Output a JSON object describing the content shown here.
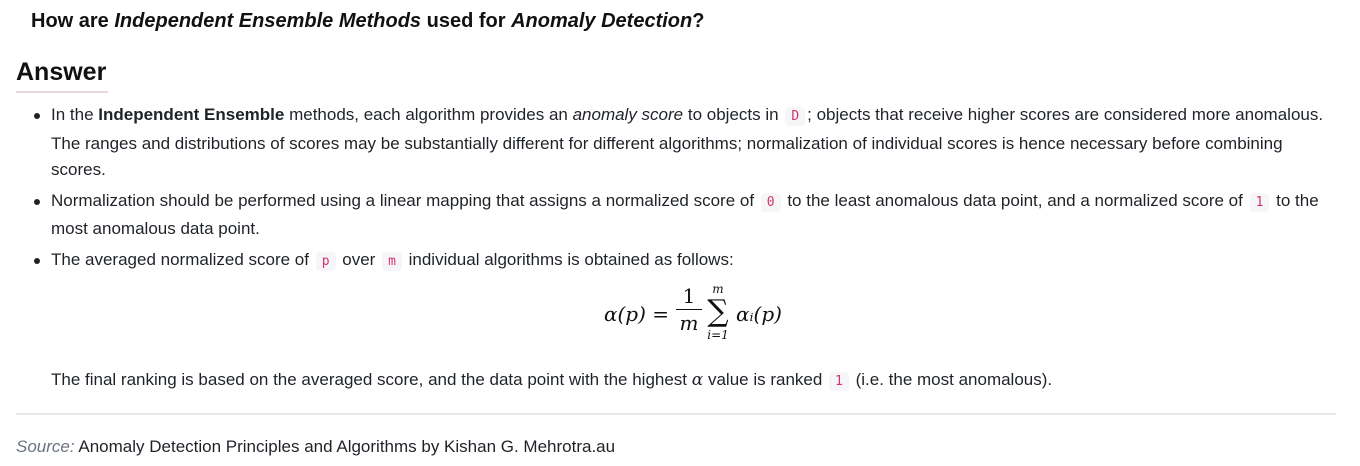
{
  "question": {
    "p1": "How are ",
    "e1": "Independent Ensemble Methods",
    "p2": " used for ",
    "e2": "Anomaly Detection",
    "p3": "?"
  },
  "answer_heading": "Answer",
  "bullets": [
    {
      "t1": "In the ",
      "b1": "Independent Ensemble",
      "t2": " methods, each algorithm provides an ",
      "em1": "anomaly score",
      "t3": " to objects in ",
      "c1": "D",
      "t4": "; objects that receive higher scores are considered more anomalous. The ranges and distributions of scores may be substantially different for different algorithms; normalization of individual scores is hence necessary before combining scores."
    },
    {
      "t1": "Normalization should be performed using a linear mapping that assigns a normalized score of ",
      "c1": "0",
      "t2": " to the least anomalous data point, and a normalized score of ",
      "c2": "1",
      "t3": " to the most anomalous data point."
    },
    {
      "t1": "The averaged normalized score of ",
      "c1": "p",
      "t2": " over ",
      "c2": "m",
      "t3": " individual algorithms is obtained as follows:"
    }
  ],
  "formula": {
    "lhs": "α(p) =",
    "num": "1",
    "den": "m",
    "upper": "m",
    "sigma": "∑",
    "lower": "i=1",
    "rhs": "αᵢ(p)"
  },
  "final": {
    "t1": "The final ranking is based on the averaged score, and the data point with the highest ",
    "alpha": "α",
    "t2": " value is ranked ",
    "c1": "1",
    "t3": " (i.e. the most anomalous)."
  },
  "source": {
    "label": "Source:",
    "text": " Anomaly Detection Principles and Algorithms by Kishan G. Mehrotra.au"
  }
}
